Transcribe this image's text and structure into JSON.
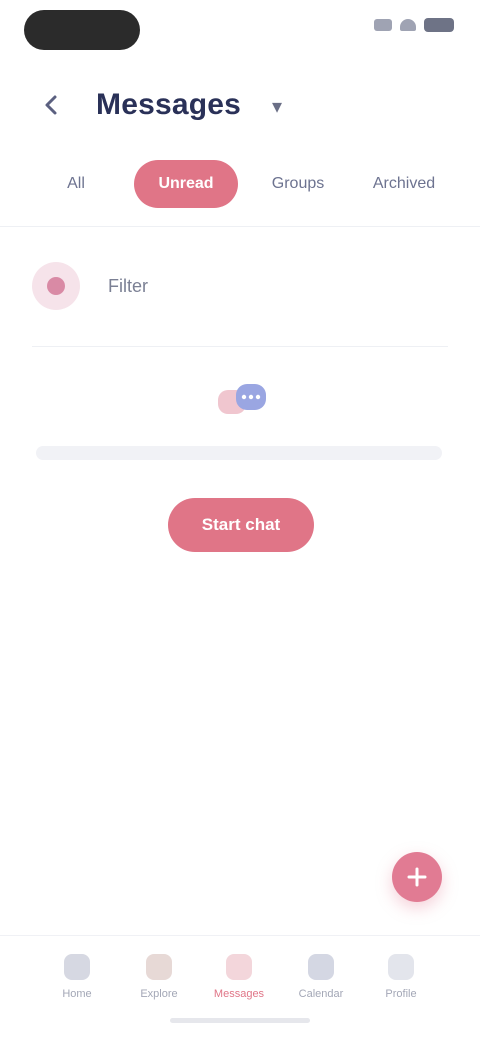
{
  "status_bar": {
    "icons": [
      "signal-icon",
      "wifi-icon",
      "battery-icon"
    ]
  },
  "header": {
    "title": "Messages",
    "back_icon": "chevron-left-icon",
    "dropdown_icon": "chevron-down-icon"
  },
  "tabs": [
    {
      "label": "All",
      "active": false
    },
    {
      "label": "Unread",
      "active": true
    },
    {
      "label": "Groups",
      "active": false
    },
    {
      "label": "Archived",
      "active": false
    }
  ],
  "filter": {
    "label": "Filter",
    "avatar_icon": "avatar-icon"
  },
  "empty_state": {
    "icon": "chat-bubbles-icon",
    "message": "",
    "button_label": "Start chat"
  },
  "fab": {
    "icon": "plus-icon"
  },
  "bottom_nav": {
    "items": [
      {
        "label": "Home",
        "icon": "home-icon"
      },
      {
        "label": "Explore",
        "icon": "compass-icon"
      },
      {
        "label": "Messages",
        "icon": "chat-icon"
      },
      {
        "label": "Calendar",
        "icon": "calendar-icon"
      },
      {
        "label": "Profile",
        "icon": "profile-icon"
      }
    ]
  },
  "colors": {
    "accent": "#e07587",
    "title": "#2a3158",
    "muted": "#7b8094"
  }
}
